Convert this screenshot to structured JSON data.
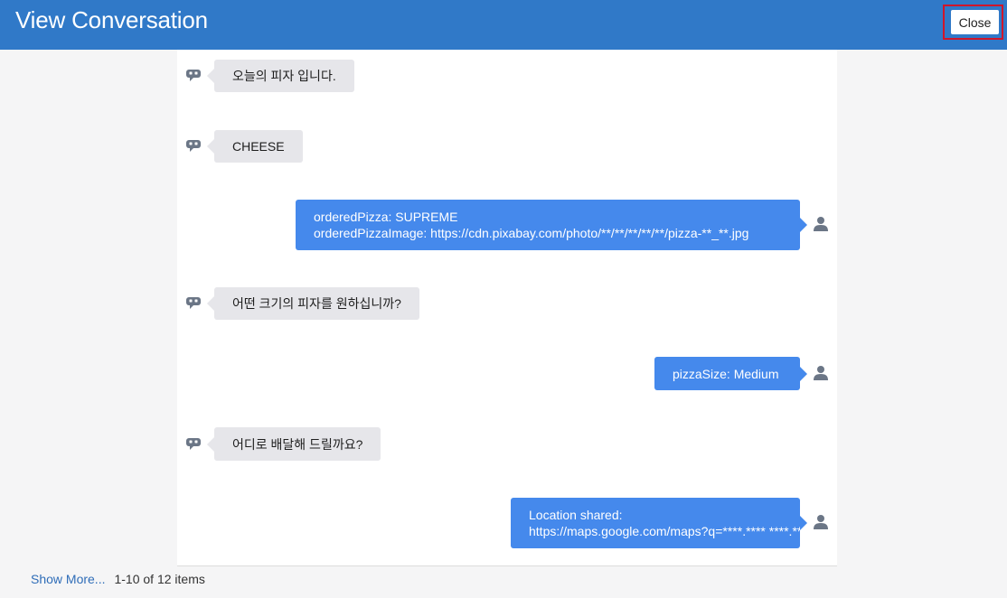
{
  "header": {
    "title": "View Conversation",
    "close_label": "Close"
  },
  "messages": [
    {
      "sender": "bot",
      "lines": [
        "오늘의 피자 입니다."
      ]
    },
    {
      "sender": "bot",
      "lines": [
        "CHEESE"
      ]
    },
    {
      "sender": "user",
      "lines": [
        "orderedPizza: SUPREME",
        "orderedPizzaImage: https://cdn.pixabay.com/photo/**/**/**/**/**/pizza-**_**.jpg"
      ]
    },
    {
      "sender": "bot",
      "lines": [
        "어떤 크기의 피자를 원하십니까?"
      ]
    },
    {
      "sender": "user",
      "lines": [
        "pizzaSize: Medium"
      ]
    },
    {
      "sender": "bot",
      "lines": [
        "어디로 배달해 드릴까요?"
      ]
    },
    {
      "sender": "user",
      "lines": [
        "Location shared:",
        "https://maps.google.com/maps?q=****.**** ****.****"
      ]
    }
  ],
  "footer": {
    "show_more": "Show More...",
    "pagination": "1-10 of 12 items"
  },
  "colors": {
    "header_bg": "#3079c8",
    "bot_bubble": "#e6e6ea",
    "user_bubble": "#4589ec",
    "icon": "#6b7686",
    "highlight_border": "#d0162a"
  },
  "icons": {
    "bot": "robot-icon",
    "user": "user-icon"
  }
}
